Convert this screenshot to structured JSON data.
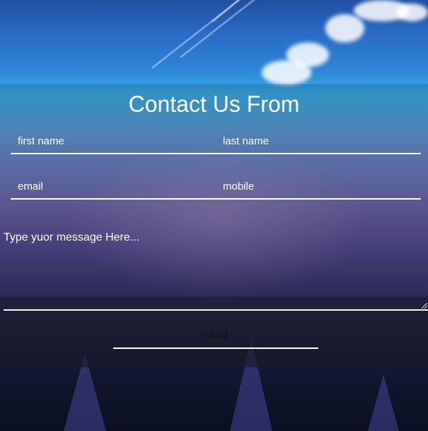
{
  "form": {
    "title": "Contact Us From",
    "first_name_placeholder": "first name",
    "last_name_placeholder": "last name",
    "email_placeholder": "email",
    "mobile_placeholder": "mobile",
    "message_placeholder": "Type yuor message Here...",
    "send_label": "send"
  },
  "colors": {
    "text": "#ffffff",
    "underline": "#ffffff",
    "send_text": "#111111"
  }
}
